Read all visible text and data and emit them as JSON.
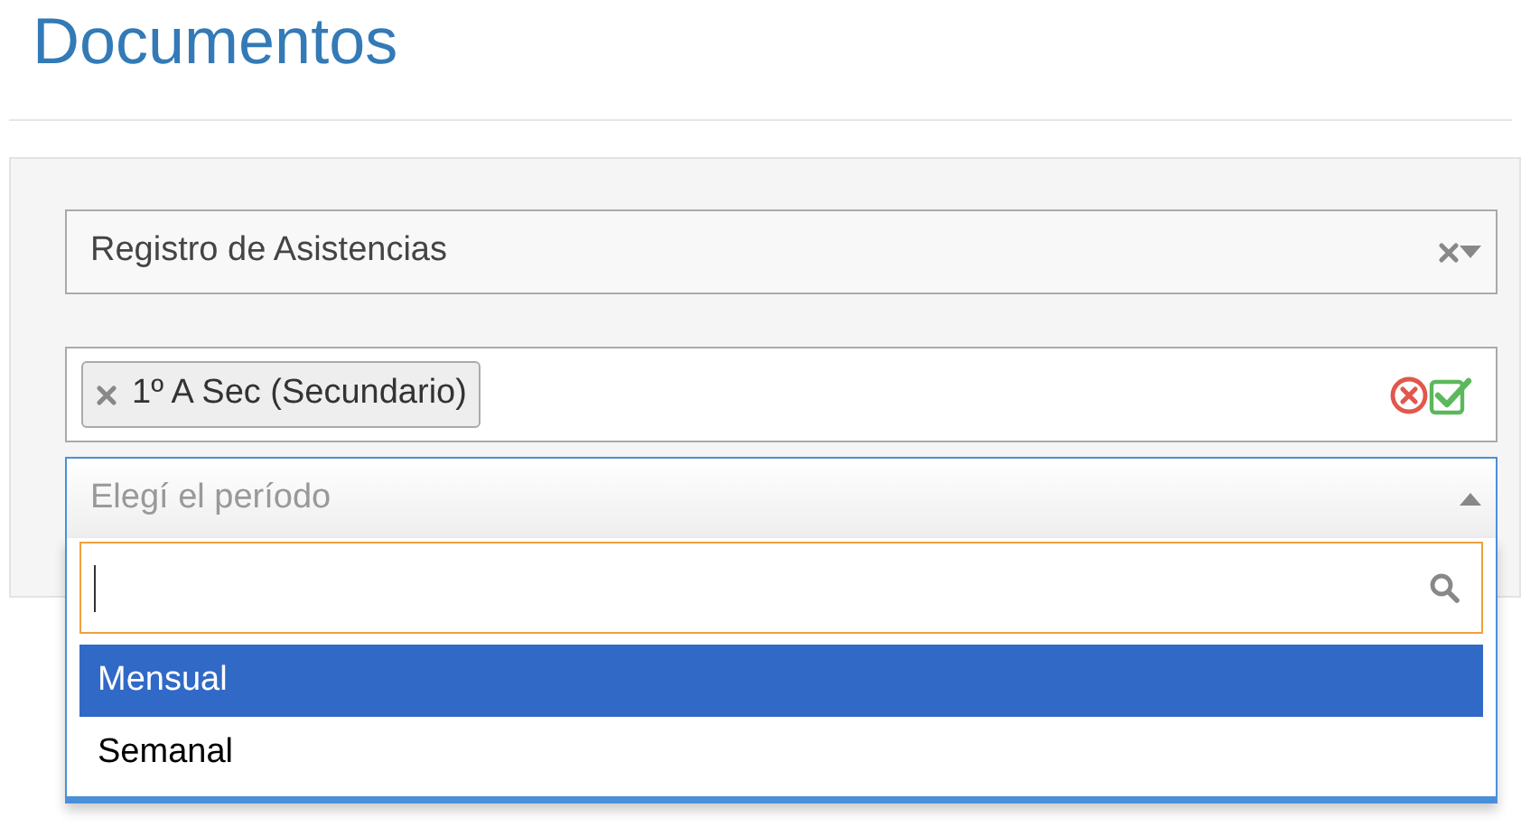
{
  "page": {
    "title": "Documentos"
  },
  "document_select": {
    "value": "Registro de Asistencias"
  },
  "group_select": {
    "tags": [
      {
        "label": "1º A Sec (Secundario)"
      }
    ]
  },
  "period_select": {
    "placeholder": "Elegí el período",
    "expanded": true,
    "options": [
      {
        "label": "Mensual",
        "selected": true
      },
      {
        "label": "Semanal",
        "selected": false
      }
    ]
  }
}
